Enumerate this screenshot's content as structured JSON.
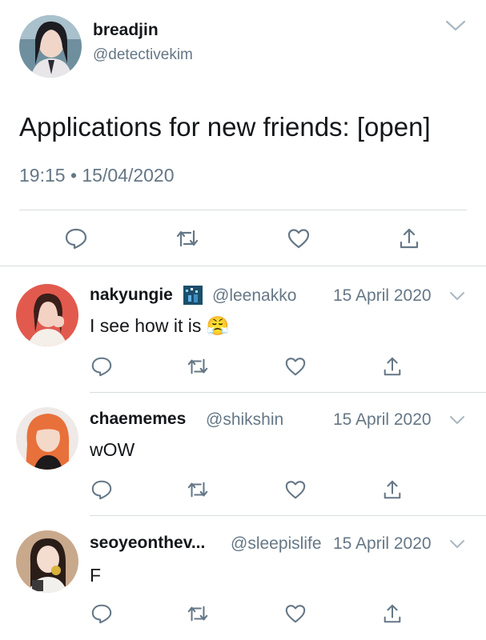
{
  "main_tweet": {
    "display_name": "breadjin",
    "handle": "@detectivekim",
    "text": "Applications for new friends: [open]",
    "timestamp": "19:15 • 15/04/2020"
  },
  "replies": [
    {
      "display_name": "nakyungie",
      "handle": "@leenakko",
      "date": "15 April 2020",
      "text": "I see how it is 😤"
    },
    {
      "display_name": "chaememes",
      "handle": "@shikshin",
      "date": "15 April 2020",
      "text": "wOW"
    },
    {
      "display_name": "seoyeonthev...",
      "handle": "@sleepislife",
      "date": "15 April 2020",
      "text": "F"
    }
  ],
  "icons": [
    "chevron-down-icon",
    "reply-icon",
    "retweet-icon",
    "like-icon",
    "share-icon"
  ],
  "colors": {
    "text": "#14171a",
    "secondary": "#657786",
    "icon": "#657786",
    "divider": "#d9dde0"
  }
}
